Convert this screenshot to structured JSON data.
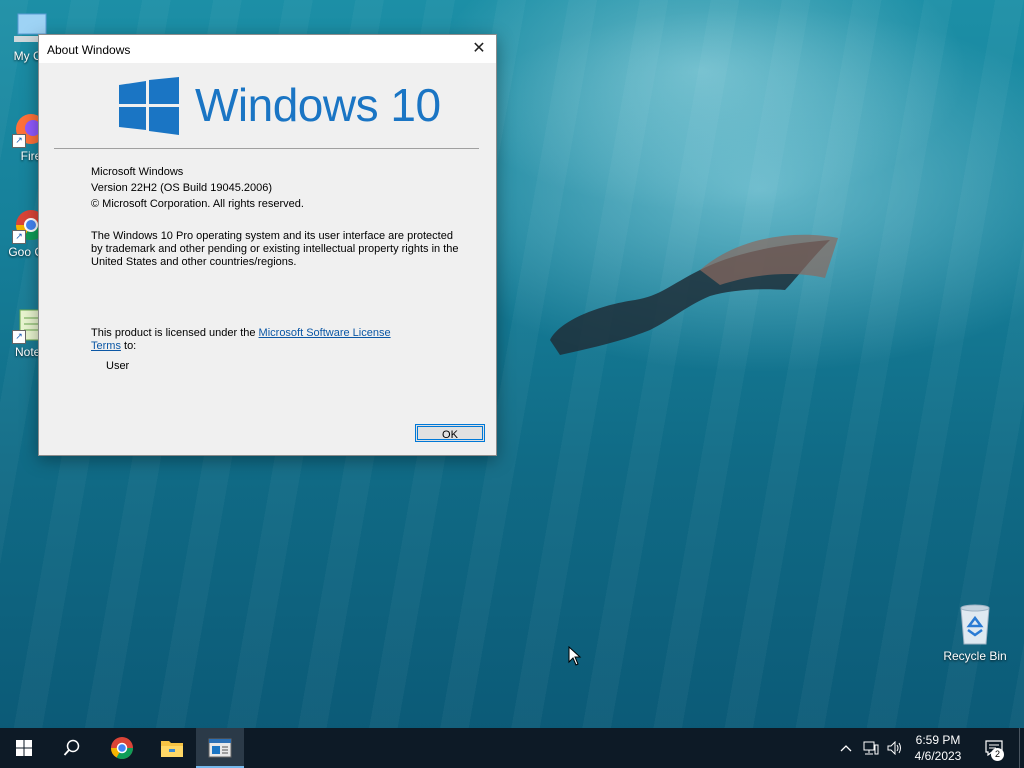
{
  "desktop": {
    "icons": [
      {
        "label": "My Co",
        "icon": "computer-icon"
      },
      {
        "label": "Fire",
        "icon": "firefox-icon"
      },
      {
        "label": "Goo Chr",
        "icon": "chrome-icon"
      },
      {
        "label": "Notep",
        "icon": "notepad-icon"
      }
    ],
    "recycle_bin": {
      "label": "Recycle Bin",
      "icon": "recycle-bin-icon"
    }
  },
  "dialog": {
    "title": "About Windows",
    "close_glyph": "✕",
    "logo_text": "Windows 10",
    "product_name": "Microsoft Windows",
    "version": "Version 22H2 (OS Build 19045.2006)",
    "copyright": "© Microsoft Corporation. All rights reserved.",
    "description": "The Windows 10 Pro operating system and its user interface are protected by trademark and other pending or existing intellectual property rights in the United States and other countries/regions.",
    "license_prefix": "This product is licensed under the ",
    "license_link": "Microsoft Software License Terms",
    "license_suffix": " to:",
    "licensed_user": "User",
    "ok_label": "OK"
  },
  "taskbar": {
    "buttons": [
      {
        "name": "start",
        "icon": "windows-start-icon"
      },
      {
        "name": "search",
        "icon": "search-icon"
      },
      {
        "name": "chrome",
        "icon": "chrome-icon"
      },
      {
        "name": "file-explorer",
        "icon": "folder-icon"
      },
      {
        "name": "winver",
        "icon": "window-app-icon",
        "active": true
      }
    ],
    "tray": {
      "time": "6:59 PM",
      "date": "4/6/2023",
      "notifications_count": "2"
    }
  },
  "colors": {
    "accent": "#0078d7",
    "windows_blue": "#1a75c4",
    "link": "#0b57a5",
    "taskbar": "#0d1a26"
  }
}
